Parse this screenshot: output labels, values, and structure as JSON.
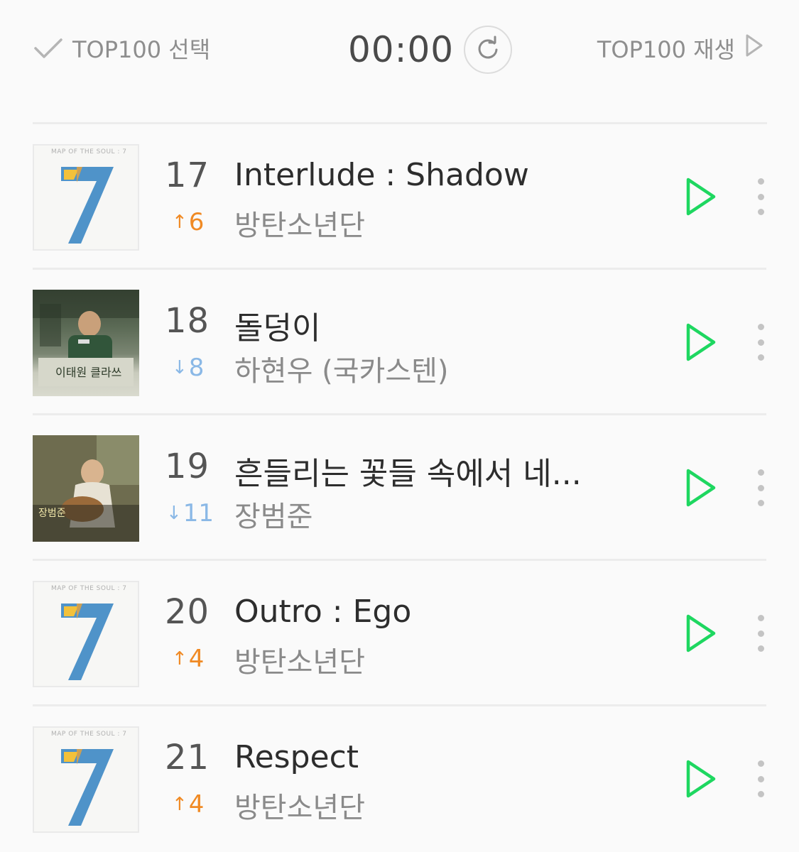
{
  "header": {
    "select_label": "TOP100 선택",
    "timer": "00:00",
    "play_label": "TOP100 재생"
  },
  "colors": {
    "play_green": "#1ed760",
    "up_orange": "#f08a24",
    "down_blue": "#8ab8e6"
  },
  "songs": [
    {
      "rank": "17",
      "change_dir": "up",
      "change_arrow": "↑",
      "change_value": "6",
      "title": "Interlude : Shadow",
      "artist": "방탄소년단",
      "art": "bts-map-of-the-soul-7"
    },
    {
      "rank": "18",
      "change_dir": "down",
      "change_arrow": "↓",
      "change_value": "8",
      "title": "돌덩이",
      "artist": "하현우 (국카스텐)",
      "art": "itaewon-class-ost"
    },
    {
      "rank": "19",
      "change_dir": "down",
      "change_arrow": "↓",
      "change_value": "11",
      "title": "흔들리는 꽃들 속에서 네...",
      "artist": "장범준",
      "art": "jang-beom-jun-guitar"
    },
    {
      "rank": "20",
      "change_dir": "up",
      "change_arrow": "↑",
      "change_value": "4",
      "title": "Outro : Ego",
      "artist": "방탄소년단",
      "art": "bts-map-of-the-soul-7"
    },
    {
      "rank": "21",
      "change_dir": "up",
      "change_arrow": "↑",
      "change_value": "4",
      "title": "Respect",
      "artist": "방탄소년단",
      "art": "bts-map-of-the-soul-7"
    }
  ]
}
